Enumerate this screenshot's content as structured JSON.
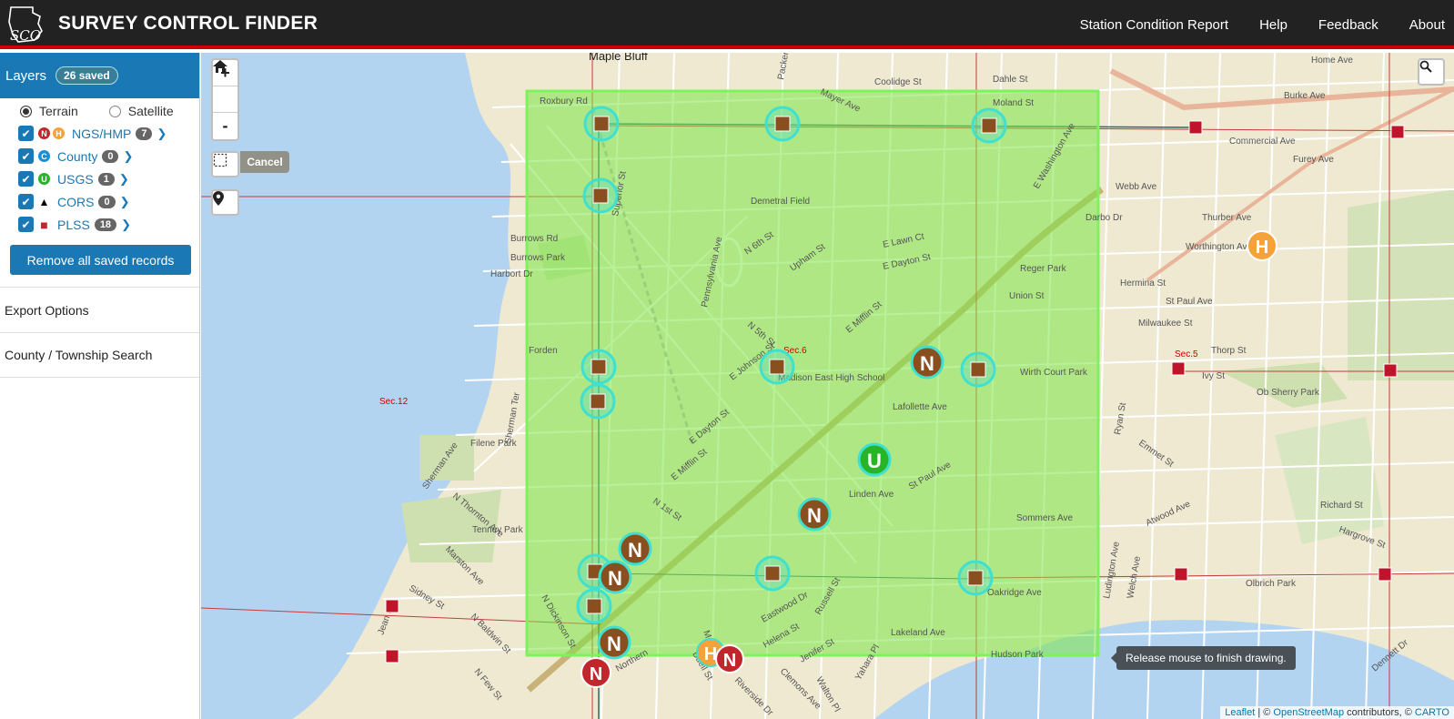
{
  "header": {
    "logo_text": "SCO",
    "title": "SURVEY CONTROL FINDER",
    "nav": [
      "Station Condition Report",
      "Help",
      "Feedback",
      "About"
    ]
  },
  "sidebar": {
    "layers_label": "Layers",
    "saved_badge": "26 saved",
    "basemaps": [
      {
        "label": "Terrain",
        "selected": true
      },
      {
        "label": "Satellite",
        "selected": false
      }
    ],
    "layers": [
      {
        "name": "NGS/HMP",
        "count": "7",
        "checked": true,
        "markers": [
          {
            "letter": "N",
            "color": "#c0272d"
          },
          {
            "letter": "H",
            "color": "#f5a23a"
          }
        ]
      },
      {
        "name": "County",
        "count": "0",
        "checked": true,
        "markers": [
          {
            "letter": "C",
            "color": "#1a8fd6"
          }
        ]
      },
      {
        "name": "USGS",
        "count": "1",
        "checked": true,
        "markers": [
          {
            "letter": "U",
            "color": "#27b527"
          }
        ]
      },
      {
        "name": "CORS",
        "count": "0",
        "checked": true,
        "markers": [
          {
            "letter": "▲",
            "color": "#000000"
          }
        ]
      },
      {
        "name": "PLSS",
        "count": "18",
        "checked": true,
        "markers": [
          {
            "letter": "■",
            "color": "#c0272d"
          }
        ]
      }
    ],
    "remove_button": "Remove all saved records",
    "sections": [
      "Export Options",
      "County / Township Search"
    ]
  },
  "map": {
    "controls": {
      "zoom_in": "+",
      "zoom_out": "-",
      "cancel": "Cancel"
    },
    "tooltip": "Release mouse to finish drawing.",
    "attribution": {
      "leaflet": "Leaflet",
      "osm": "OpenStreetMap",
      "middle": " contributors, © ",
      "carto": "CARTO"
    },
    "labels": {
      "places": [
        "Maple Bluff",
        "Sec.12",
        "Sec.6",
        "Sec.5"
      ],
      "streets": [
        "Roxbury Rd",
        "Packers Ave",
        "Mayer Ave",
        "Moland St",
        "Coolidge St",
        "Dahle St",
        "Commercial Ave",
        "Furey Ave",
        "Home Ave",
        "Burke Ave",
        "Webb Ave",
        "Darbo Dr",
        "Thurber Ave",
        "Worthington Ave",
        "Hermina St",
        "St Paul Ave",
        "Milwaukee St",
        "Thorp St",
        "Ivy St",
        "Ob Sherry Park",
        "Superior St",
        "Burrows Rd",
        "Burrows Park",
        "Harbort Dr",
        "Pennsylvania Ave",
        "Demetral Field",
        "N 6th St",
        "Upham St",
        "E Lawn Ct",
        "E Dayton St",
        "Union St",
        "Reger Park",
        "E Washington Ave",
        "N 5th St",
        "E Mifflin St",
        "E Johnson St",
        "Madison East High School",
        "Wirth Court Park",
        "Lafollette Ave",
        "Forden",
        "Filene Park",
        "Sherman Ter",
        "E Dayton St",
        "N 1st St",
        "E Mifflin St",
        "Linden Ave",
        "St Paul Ave",
        "Sommers Ave",
        "Ryan St",
        "Emmet St",
        "Richard St",
        "Hargrove St",
        "Atwood Ave",
        "Tenney Park",
        "Marston Ave",
        "N Baldwin St",
        "Sherman Ave",
        "N Thornton Ave",
        "Eastwood Dr",
        "Helena St",
        "Jenifer St",
        "Russell St",
        "Lakeland Ave",
        "Hudson Park",
        "Oakridge Ave",
        "Ludington Ave",
        "Welch Ave",
        "Olbrich Park",
        "Riverside Dr",
        "Clemons Ave",
        "Walton Pl",
        "Yahara Pl",
        "Sidney St",
        "Jean St",
        "N Dickinson St",
        "N Few St",
        "Northern",
        "Buell St",
        "Merry St",
        "Dennett Dr"
      ]
    },
    "markers": {
      "ngs_n": "N",
      "hmp_h": "H",
      "usgs_u": "U"
    }
  }
}
